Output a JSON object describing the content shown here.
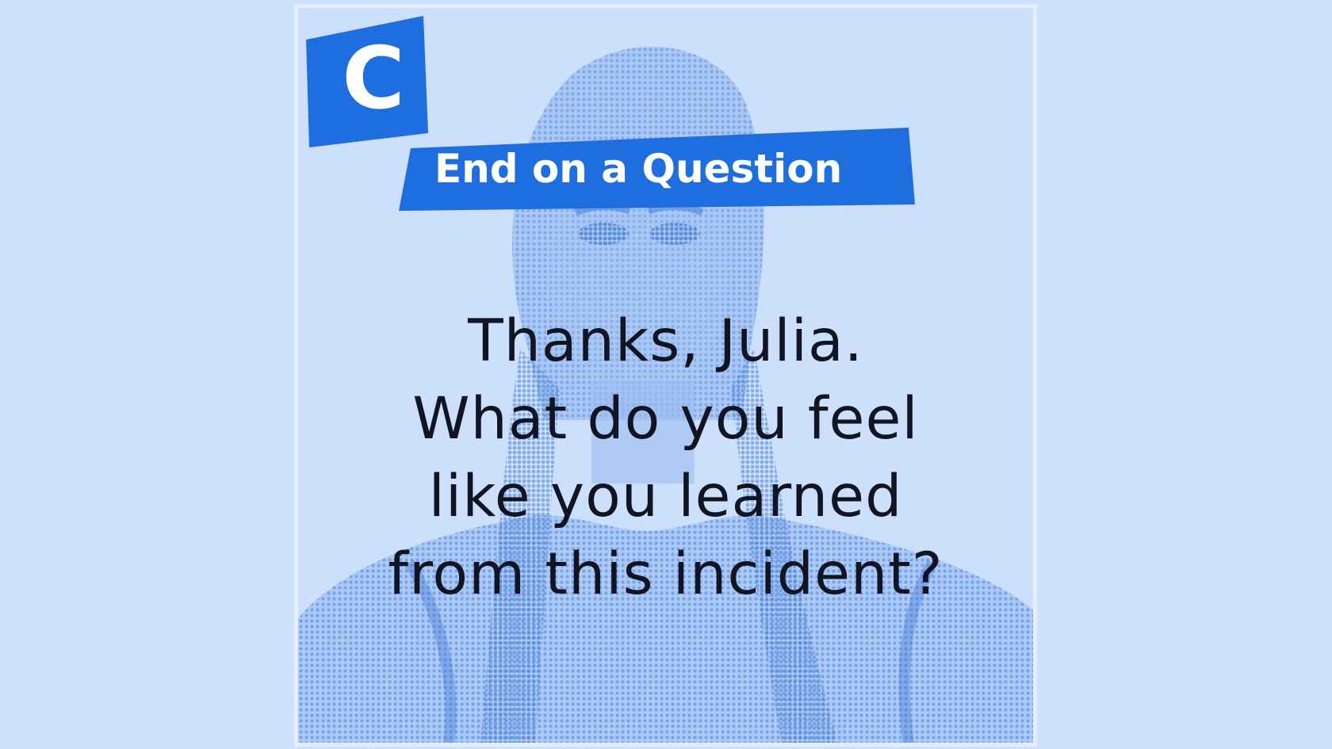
{
  "logo": {
    "letter": "C"
  },
  "banner": {
    "title": "End on a Question"
  },
  "question": {
    "lines": [
      "Thanks, Julia.",
      "What do you feel",
      "like you learned",
      "from this incident?"
    ]
  },
  "colors": {
    "page_background": "#cfe2fd",
    "card_background": "#cde0fb",
    "card_border": "#e4eeff",
    "brand_blue": "#1f6ee0",
    "portrait_tint": "#5b8fdf",
    "text": "#101423"
  }
}
